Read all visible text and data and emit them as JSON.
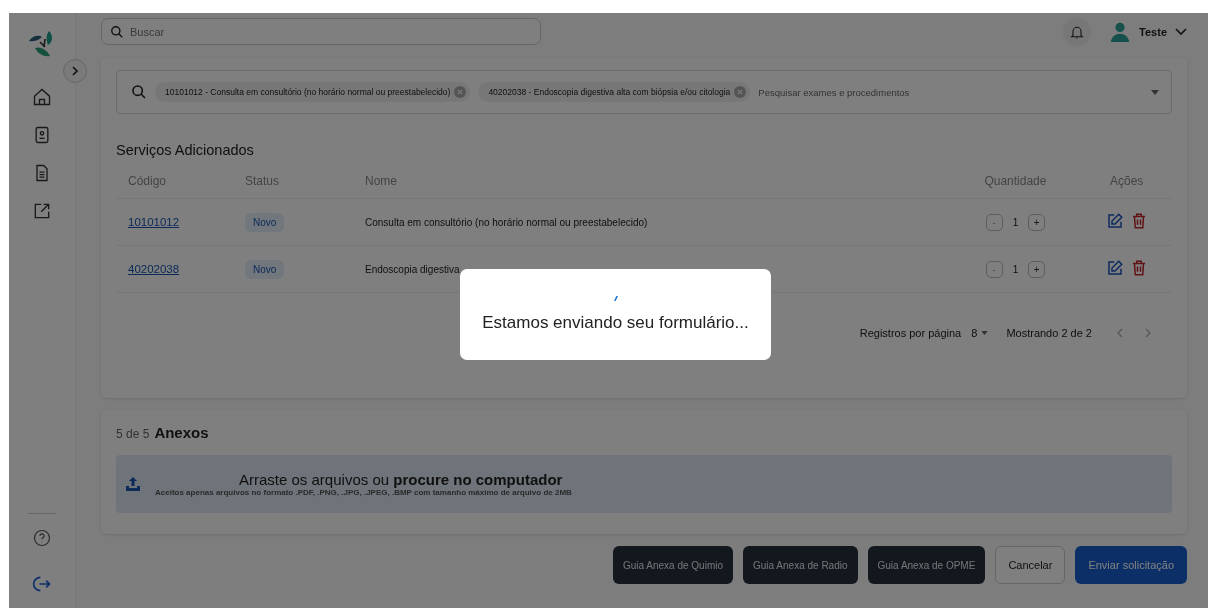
{
  "topbar": {
    "search": {
      "placeholder": "Buscar"
    },
    "user": {
      "name": "Teste"
    }
  },
  "procedure_search": {
    "tags": [
      "10101012 - Consulta em consultório (no horário normal ou preestabelecido)",
      "40202038 - Endoscopia digestiva alta com biópsia e/ou citologia"
    ],
    "placeholder": "Pesquisar exames e procedimentos"
  },
  "services": {
    "title": "Serviços Adicionados",
    "columns": [
      "Código",
      "Status",
      "Nome",
      "Quantidade",
      "Ações"
    ],
    "rows": [
      {
        "code": "10101012",
        "status": "Novo",
        "name": "Consulta em consultório (no horário normal ou preestabelecido)",
        "minus": "-",
        "quantity": "1",
        "plus": "+"
      },
      {
        "code": "40202038",
        "status": "Novo",
        "name": "Endoscopia digestiva",
        "minus": "-",
        "quantity": "1",
        "plus": "+"
      }
    ],
    "pagination": {
      "label": "Registros por página",
      "per_page": "8",
      "showing": "Mostrando 2 de 2"
    }
  },
  "attachments": {
    "count": "5 de 5",
    "title": "Anexos",
    "drop_text": "Arraste os arquivos ou **procure no computador**",
    "hint": "Aceitos apenas arquivos no formato .PDF, .PNG, .JPG, .JPEG, .BMP com tamanho máximo de arquivo de 2MB"
  },
  "actions": [
    {
      "label": "Guia Anexa de Quimio",
      "kind": "dark"
    },
    {
      "label": "Guia Anexa de Radio",
      "kind": "dark"
    },
    {
      "label": "Guia Anexa de OPME",
      "kind": "dark"
    },
    {
      "label": "Cancelar",
      "kind": "outline"
    },
    {
      "label": "Enviar solicitação",
      "kind": "primary"
    }
  ],
  "modal": {
    "message": "Estamos enviando seu formulário..."
  }
}
